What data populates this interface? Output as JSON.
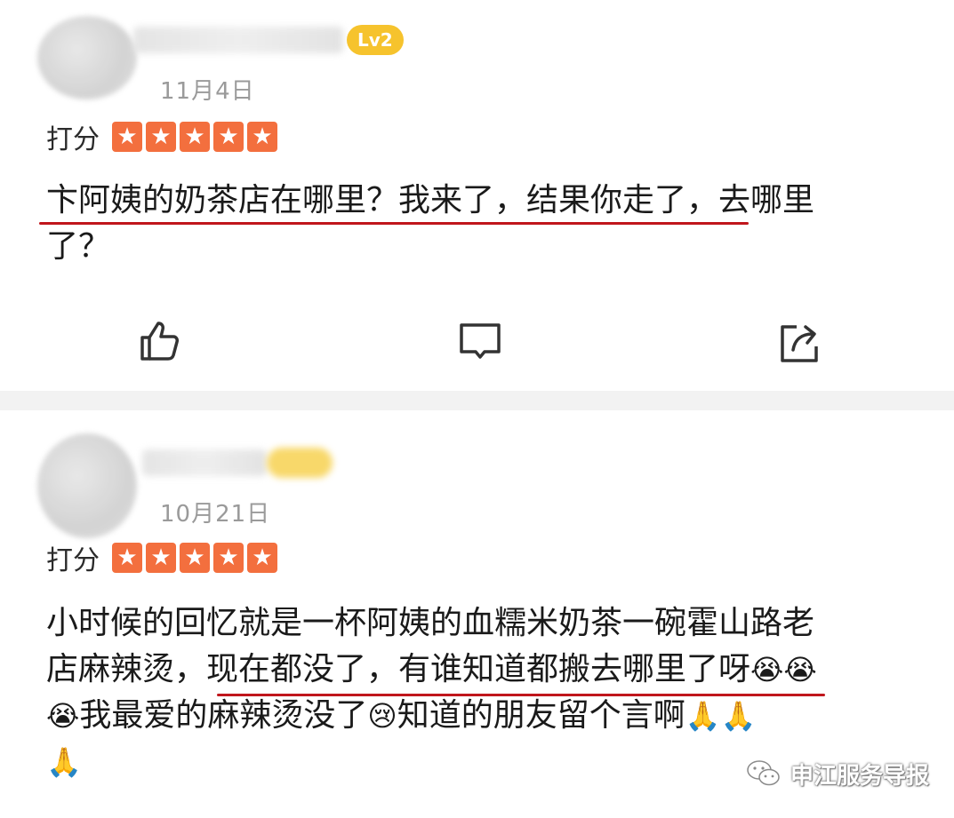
{
  "reviews": [
    {
      "badge": "Lv2",
      "date": "11月4日",
      "rating_label": "打分",
      "stars": 5,
      "lines": [
        "卞阿姨的奶茶店在哪里？我来了，结果你走了，去哪里",
        "了？"
      ],
      "actions": [
        "like-icon",
        "comment-icon",
        "share-icon"
      ]
    },
    {
      "date": "10月21日",
      "rating_label": "打分",
      "stars": 5,
      "lines": [
        "小时候的回忆就是一杯阿姨的血糯米奶茶一碗霍山路老",
        "店麻辣烫，现在都没了，有谁知道都搬去哪里了呀",
        "我最爱的麻辣烫没了",
        "知道的朋友留个言啊"
      ],
      "emoji": {
        "crying": "😭",
        "sad": "😢",
        "pray": "🙏"
      }
    }
  ],
  "watermark": {
    "text": "申江服务导报",
    "icon": "wechat-icon"
  },
  "colors": {
    "star": "#f36f3e",
    "badge": "#f6c32d",
    "underline": "#c0161c",
    "date": "#9a9a9a"
  }
}
